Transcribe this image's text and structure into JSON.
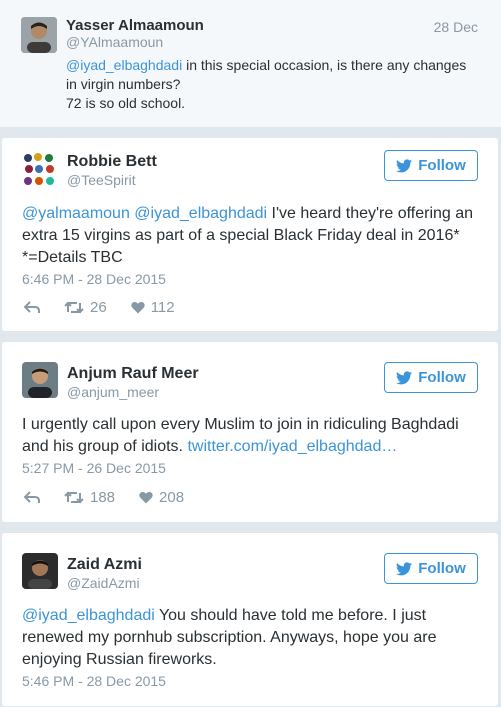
{
  "quoted": {
    "name": "Yasser Almaamoun",
    "handle": "@YAlmaamoun",
    "date": "28 Dec",
    "text_mention": "@iyad_elbaghdadi",
    "text_line1_rest": " in this special occasion, is there any changes",
    "text_line2": "in virgin numbers?",
    "text_line3": "72 is so old school."
  },
  "follow_label": "Follow",
  "tweets": [
    {
      "name": "Robbie Bett",
      "handle": "@TeeSpirit",
      "mention1": "@yalmaamoun",
      "mention2": "@iyad_elbaghdadi",
      "text_after": " I've heard they're offering an extra 15 virgins as part of a special Black Friday deal in 2016*  *=Details TBC",
      "timestamp": "6:46 PM - 28 Dec 2015",
      "retweets": "26",
      "likes": "112"
    },
    {
      "name": "Anjum Rauf Meer",
      "handle": "@anjum_meer",
      "text": "I urgently call upon every Muslim to join in ridiculing Baghdadi and his group of idiots. ",
      "link": "twitter.com/iyad_elbaghdad…",
      "timestamp": "5:27 PM - 26 Dec 2015",
      "retweets": "188",
      "likes": "208"
    },
    {
      "name": "Zaid Azmi",
      "handle": "@ZaidAzmi",
      "mention": "@iyad_elbaghdadi",
      "text_after": " You should have told me before. I just renewed my pornhub subscription. Anyways, hope you are enjoying Russian fireworks.",
      "timestamp": "5:46 PM - 28 Dec 2015"
    }
  ],
  "colors": {
    "accent": "#3b94d9",
    "muted": "#8899a6",
    "text": "#292f33",
    "background": "#e1e8ed"
  }
}
